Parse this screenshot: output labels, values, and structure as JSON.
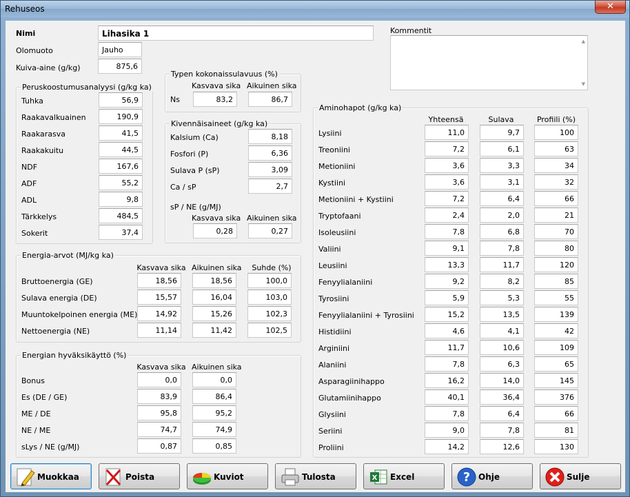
{
  "window": {
    "title": "Rehuseos",
    "close_symbol": "✕"
  },
  "nimi": {
    "label": "Nimi",
    "value": "Lihasika 1"
  },
  "olomuoto": {
    "label": "Olomuoto",
    "value": "Jauho"
  },
  "kuiva": {
    "label": "Kuiva-aine (g/kg)",
    "value": "875,6"
  },
  "kommentit": {
    "label": "Kommentit",
    "value": ""
  },
  "perus": {
    "title": "Peruskoostumusanalyysi (g/kg ka)",
    "rows": [
      {
        "label": "Tuhka",
        "value": "56,9"
      },
      {
        "label": "Raakavalkuainen",
        "value": "190,9"
      },
      {
        "label": "Raakarasva",
        "value": "41,5"
      },
      {
        "label": "Raakakuitu",
        "value": "44,5"
      },
      {
        "label": "NDF",
        "value": "167,6"
      },
      {
        "label": "ADF",
        "value": "55,2"
      },
      {
        "label": "ADL",
        "value": "9,8"
      },
      {
        "label": "Tärkkelys",
        "value": "484,5"
      },
      {
        "label": "Sokerit",
        "value": "37,4"
      }
    ]
  },
  "typen": {
    "title": "Typen kokonaissulavuus (%)",
    "col1": "Kasvava sika",
    "col2": "Aikuinen sika",
    "row_label": "Ns",
    "v1": "83,2",
    "v2": "86,7"
  },
  "kiven": {
    "title": "Kivennäisaineet (g/kg ka)",
    "rows": [
      {
        "label": "Kalsium (Ca)",
        "value": "8,18"
      },
      {
        "label": "Fosfori (P)",
        "value": "6,36"
      },
      {
        "label": "Sulava P (sP)",
        "value": "3,09"
      },
      {
        "label": "Ca / sP",
        "value": "2,7"
      }
    ],
    "spne_label": "sP / NE (g/MJ)",
    "col1": "Kasvava sika",
    "col2": "Aikuinen sika",
    "spne_v1": "0,28",
    "spne_v2": "0,27"
  },
  "energia": {
    "title": "Energia-arvot (MJ/kg ka)",
    "col1": "Kasvava sika",
    "col2": "Aikuinen sika",
    "col3": "Suhde (%)",
    "rows": [
      {
        "label": "Bruttoenergia (GE)",
        "v1": "18,56",
        "v2": "18,56",
        "v3": "100,0"
      },
      {
        "label": "Sulava energia (DE)",
        "v1": "15,57",
        "v2": "16,04",
        "v3": "103,0"
      },
      {
        "label": "Muuntokelpoinen energia (ME)",
        "v1": "14,92",
        "v2": "15,26",
        "v3": "102,3"
      },
      {
        "label": "Nettoenergia (NE)",
        "v1": "11,14",
        "v2": "11,42",
        "v3": "102,5"
      }
    ]
  },
  "hyv": {
    "title": "Energian hyväksikäyttö (%)",
    "col1": "Kasvava sika",
    "col2": "Aikuinen sika",
    "rows": [
      {
        "label": "Bonus",
        "v1": "0,0",
        "v2": "0,0"
      },
      {
        "label": "Es (DE / GE)",
        "v1": "83,9",
        "v2": "86,4"
      },
      {
        "label": "ME / DE",
        "v1": "95,8",
        "v2": "95,2"
      },
      {
        "label": "NE / ME",
        "v1": "74,7",
        "v2": "74,9"
      },
      {
        "label": "sLys / NE (g/MJ)",
        "v1": "0,87",
        "v2": "0,85"
      }
    ]
  },
  "amino": {
    "title": "Aminohapot (g/kg ka)",
    "col1": "Yhteensä",
    "col2": "Sulava",
    "col3": "Profiili (%)",
    "rows": [
      {
        "label": "Lysiini",
        "v1": "11,0",
        "v2": "9,7",
        "v3": "100"
      },
      {
        "label": "Treoniini",
        "v1": "7,2",
        "v2": "6,1",
        "v3": "63"
      },
      {
        "label": "Metioniini",
        "v1": "3,6",
        "v2": "3,3",
        "v3": "34"
      },
      {
        "label": "Kystiini",
        "v1": "3,6",
        "v2": "3,1",
        "v3": "32"
      },
      {
        "label": "Metioniini + Kystiini",
        "v1": "7,2",
        "v2": "6,4",
        "v3": "66"
      },
      {
        "label": "Tryptofaani",
        "v1": "2,4",
        "v2": "2,0",
        "v3": "21"
      },
      {
        "label": "Isoleusiini",
        "v1": "7,8",
        "v2": "6,8",
        "v3": "70"
      },
      {
        "label": "Valiini",
        "v1": "9,1",
        "v2": "7,8",
        "v3": "80"
      },
      {
        "label": "Leusiini",
        "v1": "13,3",
        "v2": "11,7",
        "v3": "120"
      },
      {
        "label": "Fenyylialaniini",
        "v1": "9,2",
        "v2": "8,2",
        "v3": "85"
      },
      {
        "label": "Tyrosiini",
        "v1": "5,9",
        "v2": "5,3",
        "v3": "55"
      },
      {
        "label": "Fenyylialaniini + Tyrosiini",
        "v1": "15,2",
        "v2": "13,5",
        "v3": "139"
      },
      {
        "label": "Histidiini",
        "v1": "4,6",
        "v2": "4,1",
        "v3": "42"
      },
      {
        "label": "Arginiini",
        "v1": "11,7",
        "v2": "10,6",
        "v3": "109"
      },
      {
        "label": "Alaniini",
        "v1": "7,8",
        "v2": "6,3",
        "v3": "65"
      },
      {
        "label": "Asparagiinihappo",
        "v1": "16,2",
        "v2": "14,0",
        "v3": "145"
      },
      {
        "label": "Glutamiinihappo",
        "v1": "40,1",
        "v2": "36,4",
        "v3": "376"
      },
      {
        "label": "Glysiini",
        "v1": "7,8",
        "v2": "6,4",
        "v3": "66"
      },
      {
        "label": "Seriini",
        "v1": "9,0",
        "v2": "7,8",
        "v3": "81"
      },
      {
        "label": "Proliini",
        "v1": "14,2",
        "v2": "12,6",
        "v3": "130"
      }
    ]
  },
  "buttons": {
    "muokkaa": {
      "label": "Muokkaa",
      "icon": "pencil-icon"
    },
    "poista": {
      "label": "Poista",
      "icon": "delete-cross-icon"
    },
    "kuviot": {
      "label": "Kuviot",
      "icon": "pie-chart-icon"
    },
    "tulosta": {
      "label": "Tulosta",
      "icon": "printer-icon"
    },
    "excel": {
      "label": "Excel",
      "icon": "excel-icon"
    },
    "ohje": {
      "label": "Ohje",
      "icon": "help-icon"
    },
    "sulje": {
      "label": "Sulje",
      "icon": "close-red-icon"
    }
  }
}
